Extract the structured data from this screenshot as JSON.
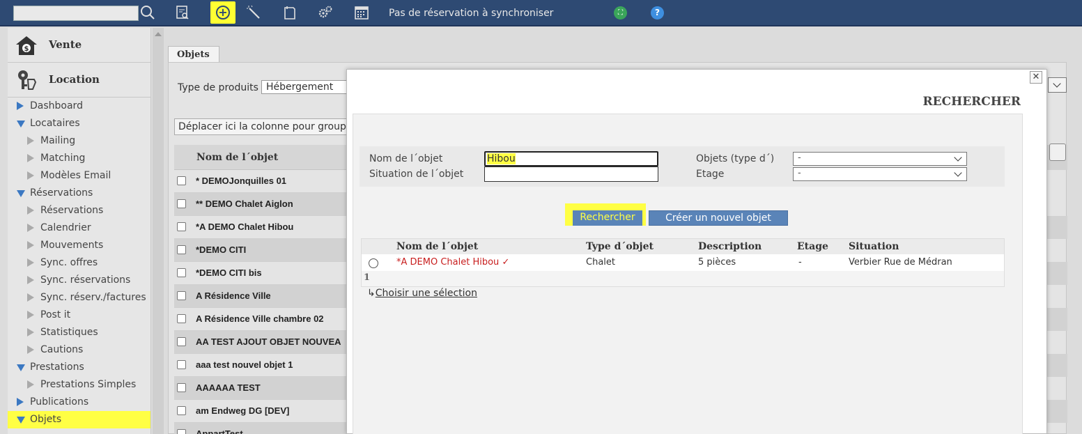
{
  "topbar": {
    "search_placeholder": "",
    "status_message": "Pas de réservation à synchroniser",
    "icons": [
      "search-icon",
      "report-icon",
      "add-circle-icon",
      "magic-wand-icon",
      "note-icon",
      "gears-icon",
      "calendar-icon",
      "fullscreen-icon",
      "help-icon"
    ],
    "accent_color": "#ffff33",
    "bar_color": "#2e4a73"
  },
  "sidebar": {
    "vente_label": "Vente",
    "location_label": "Location",
    "items": [
      {
        "label": "Dashboard",
        "level": 1,
        "state": "collapsed"
      },
      {
        "label": "Locataires",
        "level": 1,
        "state": "expanded"
      },
      {
        "label": "Mailing",
        "level": 2
      },
      {
        "label": "Matching",
        "level": 2
      },
      {
        "label": "Modèles Email",
        "level": 2
      },
      {
        "label": "Réservations",
        "level": 1,
        "state": "expanded"
      },
      {
        "label": "Réservations",
        "level": 2
      },
      {
        "label": "Calendrier",
        "level": 2
      },
      {
        "label": "Mouvements",
        "level": 2
      },
      {
        "label": "Sync. offres",
        "level": 2
      },
      {
        "label": "Sync. réservations",
        "level": 2
      },
      {
        "label": "Sync. réserv./factures",
        "level": 2
      },
      {
        "label": "Post it",
        "level": 2
      },
      {
        "label": "Statistiques",
        "level": 2
      },
      {
        "label": "Cautions",
        "level": 2
      },
      {
        "label": "Prestations",
        "level": 1,
        "state": "expanded"
      },
      {
        "label": "Prestations Simples",
        "level": 2
      },
      {
        "label": "Publications",
        "level": 1,
        "state": "collapsed"
      },
      {
        "label": "Objets",
        "level": 1,
        "state": "expanded",
        "highlight": true
      }
    ]
  },
  "main": {
    "tab_label": "Objets",
    "type_label": "Type de produits",
    "type_value": "Hébergement",
    "group_hint": "Déplacer ici la colonne pour groupe",
    "grid_header": "Nom de l´objet",
    "rows": [
      "* DEMOJonquilles 01",
      "** DEMO Chalet Aiglon",
      "*A DEMO Chalet Hibou",
      "*DEMO CITI",
      "*DEMO CITI bis",
      "A Résidence Ville",
      "A Résidence Ville chambre 02",
      "AA TEST AJOUT OBJET NOUVEA",
      "aaa test nouvel objet 1",
      "AAAAAA TEST",
      "am Endweg DG [DEV]",
      "AppartTest"
    ]
  },
  "modal": {
    "title": "RECHERCHER",
    "close_label": "✕",
    "form": {
      "name_label": "Nom de l´objet",
      "name_value": "Hibou",
      "situation_label": "Situation de l´objet",
      "situation_value": "",
      "type_label": "Objets (type d´)",
      "type_value": "-",
      "etage_label": "Etage",
      "etage_value": "-"
    },
    "search_button": "Rechercher",
    "new_button": "Créer un nouvel objet",
    "results": {
      "headers": [
        "Nom de l´objet",
        "Type d´objet",
        "Description",
        "Etage",
        "Situation"
      ],
      "rows": [
        {
          "name": "*A DEMO Chalet Hibou",
          "check": "✓",
          "type": "Chalet",
          "description": "5 pièces",
          "etage": "-",
          "situation": "Verbier Rue de Médran"
        }
      ],
      "page": "1"
    },
    "choose_label": "Choisir une sélection"
  }
}
